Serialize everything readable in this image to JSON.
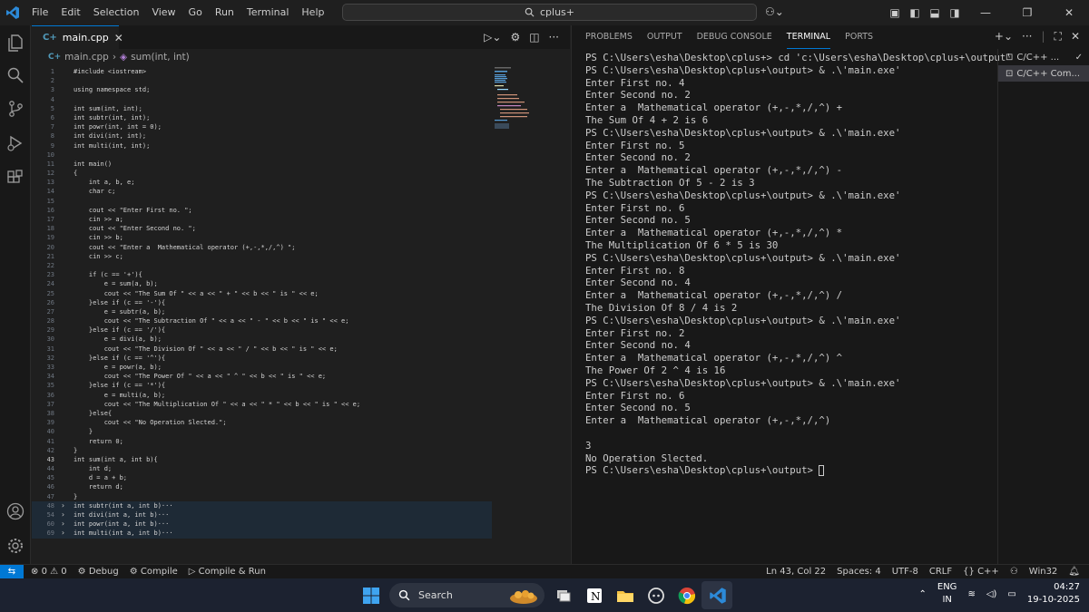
{
  "menu": [
    "File",
    "Edit",
    "Selection",
    "View",
    "Go",
    "Run",
    "Terminal",
    "Help"
  ],
  "search": {
    "text": "cplus+"
  },
  "editor": {
    "tab_label": "main.cpp",
    "breadcrumb_file": "main.cpp",
    "breadcrumb_symbol": "sum(int, int)",
    "lines": [
      {
        "n": "1",
        "t": "#include <iostream>"
      },
      {
        "n": "2",
        "t": ""
      },
      {
        "n": "3",
        "t": "using namespace std;"
      },
      {
        "n": "4",
        "t": ""
      },
      {
        "n": "5",
        "t": "int sum(int, int);"
      },
      {
        "n": "6",
        "t": "int subtr(int, int);"
      },
      {
        "n": "7",
        "t": "int powr(int, int = 0);"
      },
      {
        "n": "8",
        "t": "int divi(int, int);"
      },
      {
        "n": "9",
        "t": "int multi(int, int);"
      },
      {
        "n": "10",
        "t": ""
      },
      {
        "n": "11",
        "t": "int main()"
      },
      {
        "n": "12",
        "t": "{"
      },
      {
        "n": "13",
        "t": "    int a, b, e;"
      },
      {
        "n": "14",
        "t": "    char c;"
      },
      {
        "n": "15",
        "t": ""
      },
      {
        "n": "16",
        "t": "    cout << \"Enter First no. \";"
      },
      {
        "n": "17",
        "t": "    cin >> a;"
      },
      {
        "n": "18",
        "t": "    cout << \"Enter Second no. \";"
      },
      {
        "n": "19",
        "t": "    cin >> b;"
      },
      {
        "n": "20",
        "t": "    cout << \"Enter a  Mathematical operator (+,-,*,/,^) \";"
      },
      {
        "n": "21",
        "t": "    cin >> c;"
      },
      {
        "n": "22",
        "t": ""
      },
      {
        "n": "23",
        "t": "    if (c == '+'){"
      },
      {
        "n": "24",
        "t": "        e = sum(a, b);"
      },
      {
        "n": "25",
        "t": "        cout << \"The Sum Of \" << a << \" + \" << b << \" is \" << e;"
      },
      {
        "n": "26",
        "t": "    }else if (c == '-'){"
      },
      {
        "n": "27",
        "t": "        e = subtr(a, b);"
      },
      {
        "n": "28",
        "t": "        cout << \"The Subtraction Of \" << a << \" - \" << b << \" is \" << e;"
      },
      {
        "n": "29",
        "t": "    }else if (c == '/'){"
      },
      {
        "n": "30",
        "t": "        e = divi(a, b);"
      },
      {
        "n": "31",
        "t": "        cout << \"The Division Of \" << a << \" / \" << b << \" is \" << e;"
      },
      {
        "n": "32",
        "t": "    }else if (c == '^'){"
      },
      {
        "n": "33",
        "t": "        e = powr(a, b);"
      },
      {
        "n": "34",
        "t": "        cout << \"The Power Of \" << a << \" ^ \" << b << \" is \" << e;"
      },
      {
        "n": "35",
        "t": "    }else if (c == '*'){"
      },
      {
        "n": "36",
        "t": "        e = multi(a, b);"
      },
      {
        "n": "37",
        "t": "        cout << \"The Multiplication Of \" << a << \" * \" << b << \" is \" << e;"
      },
      {
        "n": "38",
        "t": "    }else{"
      },
      {
        "n": "39",
        "t": "        cout << \"No Operation Slected.\";"
      },
      {
        "n": "40",
        "t": "    }"
      },
      {
        "n": "41",
        "t": "    return 0;"
      },
      {
        "n": "42",
        "t": "}"
      },
      {
        "n": "43",
        "t": "int sum(int a, int b){"
      },
      {
        "n": "44",
        "t": "    int d;"
      },
      {
        "n": "45",
        "t": "    d = a + b;"
      },
      {
        "n": "46",
        "t": "    return d;"
      },
      {
        "n": "47",
        "t": "}"
      },
      {
        "n": "48",
        "t": "int subtr(int a, int b)···"
      },
      {
        "n": "54",
        "t": "int divi(int a, int b)···"
      },
      {
        "n": "60",
        "t": "int powr(int a, int b)···"
      },
      {
        "n": "69",
        "t": "int multi(int a, int b)···"
      }
    ]
  },
  "panel": {
    "tabs": [
      "PROBLEMS",
      "OUTPUT",
      "DEBUG CONSOLE",
      "TERMINAL",
      "PORTS"
    ],
    "active_tab": "TERMINAL",
    "terminal_lines": [
      "PS C:\\Users\\esha\\Desktop\\cplus+> cd 'c:\\Users\\esha\\Desktop\\cplus+\\output'",
      "PS C:\\Users\\esha\\Desktop\\cplus+\\output> & .\\'main.exe'",
      "Enter First no. 4",
      "Enter Second no. 2",
      "Enter a  Mathematical operator (+,-,*,/,^) +",
      "The Sum Of 4 + 2 is 6",
      "PS C:\\Users\\esha\\Desktop\\cplus+\\output> & .\\'main.exe'",
      "Enter First no. 5",
      "Enter Second no. 2",
      "Enter a  Mathematical operator (+,-,*,/,^) -",
      "The Subtraction Of 5 - 2 is 3",
      "PS C:\\Users\\esha\\Desktop\\cplus+\\output> & .\\'main.exe'",
      "Enter First no. 6",
      "Enter Second no. 5",
      "Enter a  Mathematical operator (+,-,*,/,^) *",
      "The Multiplication Of 6 * 5 is 30",
      "PS C:\\Users\\esha\\Desktop\\cplus+\\output> & .\\'main.exe'",
      "Enter First no. 8",
      "Enter Second no. 4",
      "Enter a  Mathematical operator (+,-,*,/,^) /",
      "The Division Of 8 / 4 is 2",
      "PS C:\\Users\\esha\\Desktop\\cplus+\\output> & .\\'main.exe'",
      "Enter First no. 2",
      "Enter Second no. 4",
      "Enter a  Mathematical operator (+,-,*,/,^) ^",
      "The Power Of 2 ^ 4 is 16",
      "PS C:\\Users\\esha\\Desktop\\cplus+\\output> & .\\'main.exe'",
      "Enter First no. 6",
      "Enter Second no. 5",
      "Enter a  Mathematical operator (+,-,*,/,^)",
      "",
      "3",
      "No Operation Slected.",
      "PS C:\\Users\\esha\\Desktop\\cplus+\\output> "
    ],
    "terminal_list": [
      "C/C++ ...",
      "C/C++ Com..."
    ]
  },
  "status": {
    "errors": "0",
    "warnings": "0",
    "debug": "Debug",
    "compile": "Compile",
    "compile_run": "Compile & Run",
    "position": "Ln 43, Col 22",
    "spaces": "Spaces: 4",
    "encoding": "UTF-8",
    "eol": "CRLF",
    "language": "C++",
    "platform": "Win32"
  },
  "taskbar": {
    "search": "Search",
    "lang_top": "ENG",
    "lang_bottom": "IN",
    "time": "04:27",
    "date": "19-10-2025"
  },
  "colors": {
    "accent": "#0078d4",
    "background": "#1f1f1f",
    "taskbar": "#1c2230"
  }
}
